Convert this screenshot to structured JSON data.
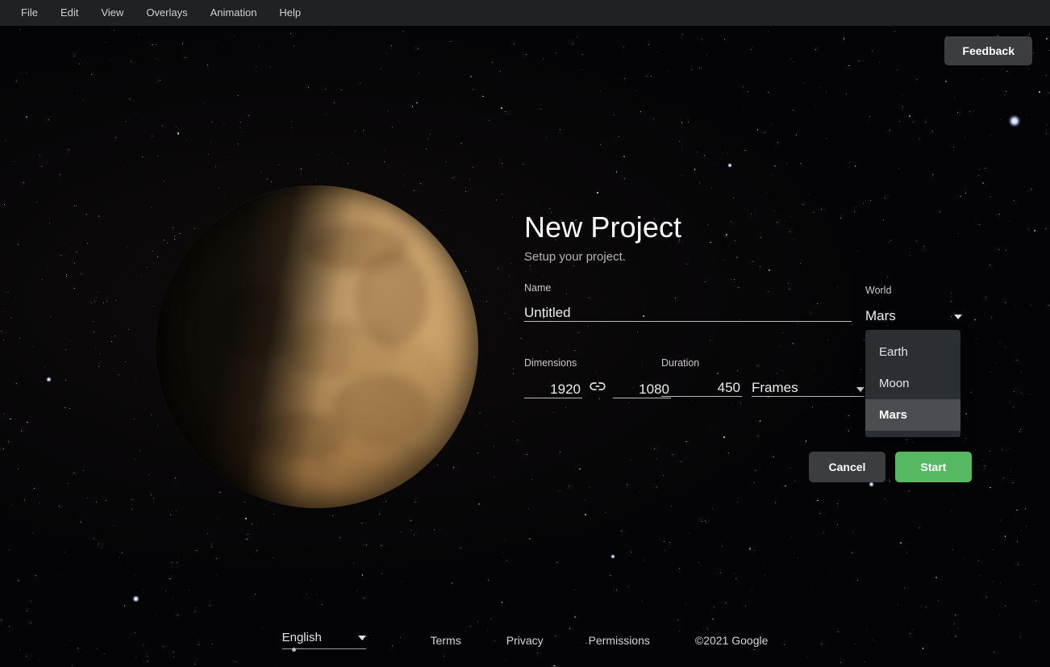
{
  "menubar": {
    "items": [
      {
        "label": "File"
      },
      {
        "label": "Edit"
      },
      {
        "label": "View"
      },
      {
        "label": "Overlays"
      },
      {
        "label": "Animation"
      },
      {
        "label": "Help"
      }
    ]
  },
  "feedback": {
    "label": "Feedback"
  },
  "dialog": {
    "title": "New Project",
    "subtitle": "Setup your project.",
    "name_field": {
      "label": "Name",
      "value": "Untitled"
    },
    "world_field": {
      "label": "World",
      "value": "Mars",
      "caret_icon": "chevron-down-icon",
      "options": [
        {
          "label": "Earth",
          "selected": false
        },
        {
          "label": "Moon",
          "selected": false
        },
        {
          "label": "Mars",
          "selected": true
        }
      ]
    },
    "dimensions_field": {
      "label": "Dimensions",
      "width": "1920",
      "height": "1080",
      "link_icon": "link-icon"
    },
    "duration_field": {
      "label": "Duration",
      "value": "450",
      "unit": "Frames",
      "caret_icon": "chevron-down-icon"
    },
    "buttons": {
      "cancel": "Cancel",
      "start": "Start"
    }
  },
  "footer": {
    "language": "English",
    "language_caret": "chevron-down-icon",
    "links": [
      {
        "label": "Terms"
      },
      {
        "label": "Privacy"
      },
      {
        "label": "Permissions"
      }
    ],
    "copyright": "©2021 Google"
  },
  "scene": {
    "planet": "Mars",
    "background": "starfield"
  },
  "colors": {
    "menubar_bg": "#202124",
    "page_bg": "#050505",
    "start_button": "#56b961",
    "cancel_button": "#3b3d41",
    "dropdown_bg": "#2b2e32",
    "dropdown_selected": "#4a4d52",
    "planet_light": "#caa068",
    "planet_dark": "#53391f"
  }
}
